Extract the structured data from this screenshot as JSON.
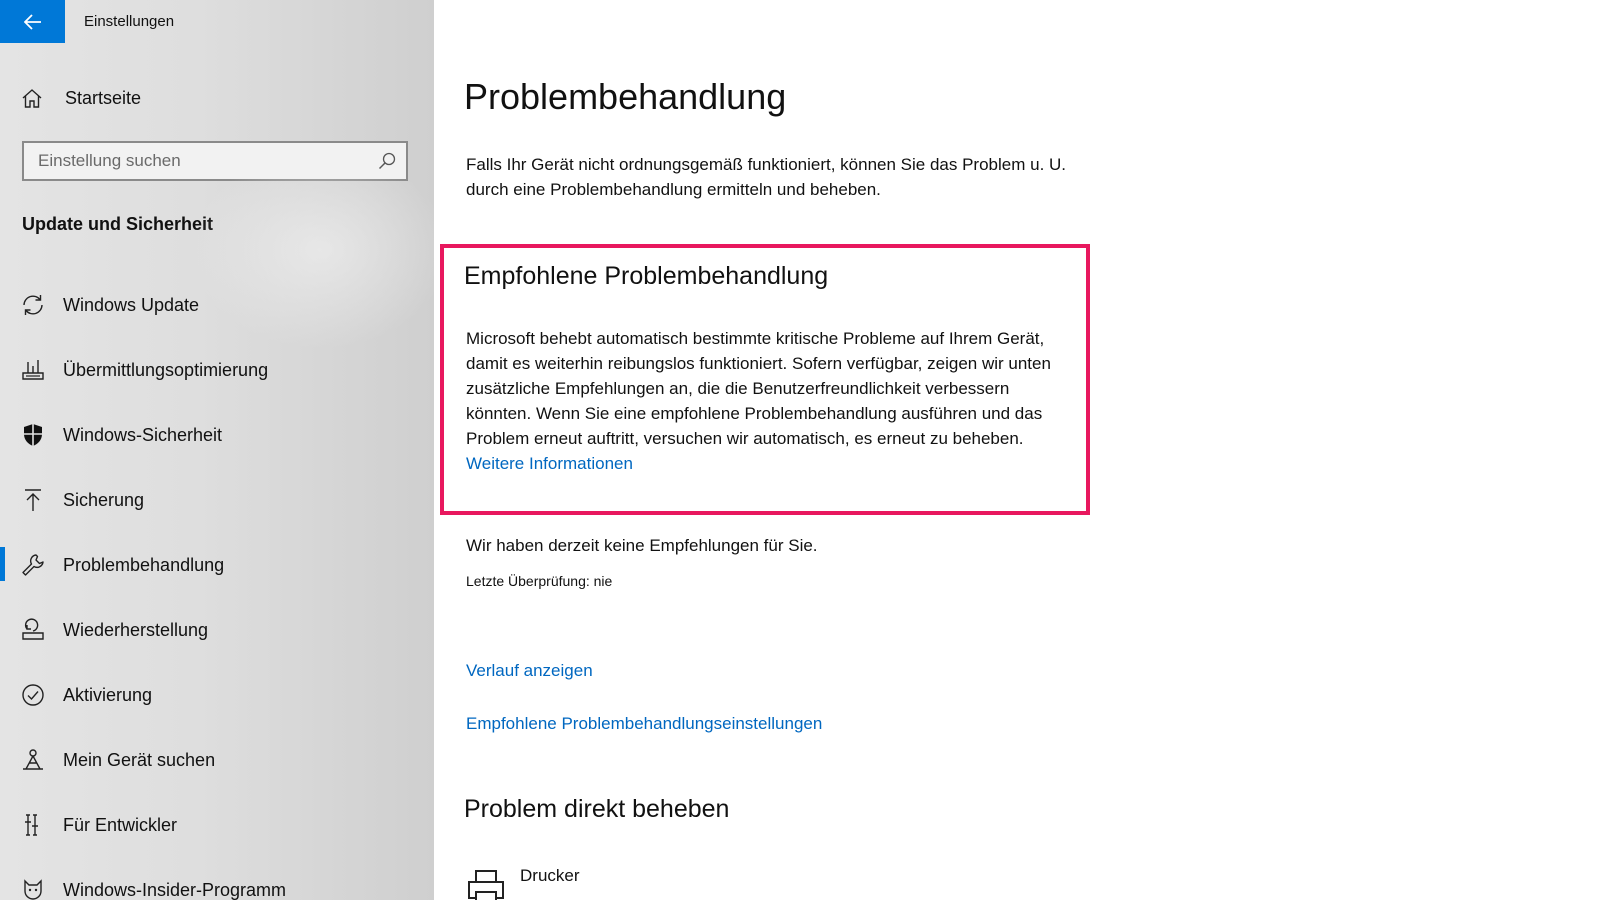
{
  "window": {
    "title": "Einstellungen",
    "back_icon": "arrow-left-icon",
    "accent_color": "#0078d7"
  },
  "sidebar": {
    "home": {
      "label": "Startseite",
      "icon": "home-icon"
    },
    "search": {
      "placeholder": "Einstellung suchen",
      "value": "",
      "icon": "search-icon"
    },
    "section_heading": "Update und Sicherheit",
    "items": [
      {
        "label": "Windows Update",
        "icon": "sync-icon",
        "active": false
      },
      {
        "label": "Übermittlungsoptimierung",
        "icon": "delivery-optimization-icon",
        "active": false
      },
      {
        "label": "Windows-Sicherheit",
        "icon": "shield-icon",
        "active": false
      },
      {
        "label": "Sicherung",
        "icon": "backup-upload-icon",
        "active": false
      },
      {
        "label": "Problembehandlung",
        "icon": "wrench-icon",
        "active": true
      },
      {
        "label": "Wiederherstellung",
        "icon": "recovery-icon",
        "active": false
      },
      {
        "label": "Aktivierung",
        "icon": "check-circle-icon",
        "active": false
      },
      {
        "label": "Mein Gerät suchen",
        "icon": "find-device-icon",
        "active": false
      },
      {
        "label": "Für Entwickler",
        "icon": "developer-tools-icon",
        "active": false
      },
      {
        "label": "Windows-Insider-Programm",
        "icon": "insider-cat-icon",
        "active": false
      }
    ]
  },
  "main": {
    "title": "Problembehandlung",
    "intro": "Falls Ihr Gerät nicht ordnungsgemäß funktioniert, können Sie das Problem u. U. durch eine Problembehandlung ermitteln und beheben.",
    "recommended": {
      "heading": "Empfohlene Problembehandlung",
      "text": "Microsoft behebt automatisch bestimmte kritische Probleme auf Ihrem Gerät, damit es weiterhin reibungslos funktioniert. Sofern verfügbar, zeigen wir unten zusätzliche Empfehlungen an, die die Benutzerfreundlichkeit verbessern könnten. Wenn Sie eine empfohlene Problembehandlung ausführen und das Problem erneut auftritt, versuchen wir automatisch, es erneut zu beheben.",
      "link": "Weitere Informationen",
      "highlight_color": "#e8185e"
    },
    "no_recommendations": "Wir haben derzeit keine Empfehlungen für Sie.",
    "last_check": "Letzte Überprüfung: nie",
    "links": {
      "history": "Verlauf anzeigen",
      "settings": "Empfohlene Problembehandlungseinstellungen"
    },
    "direct": {
      "heading": "Problem direkt beheben",
      "items": [
        {
          "label": "Drucker",
          "icon": "printer-icon"
        }
      ]
    },
    "link_color": "#0067c0"
  }
}
